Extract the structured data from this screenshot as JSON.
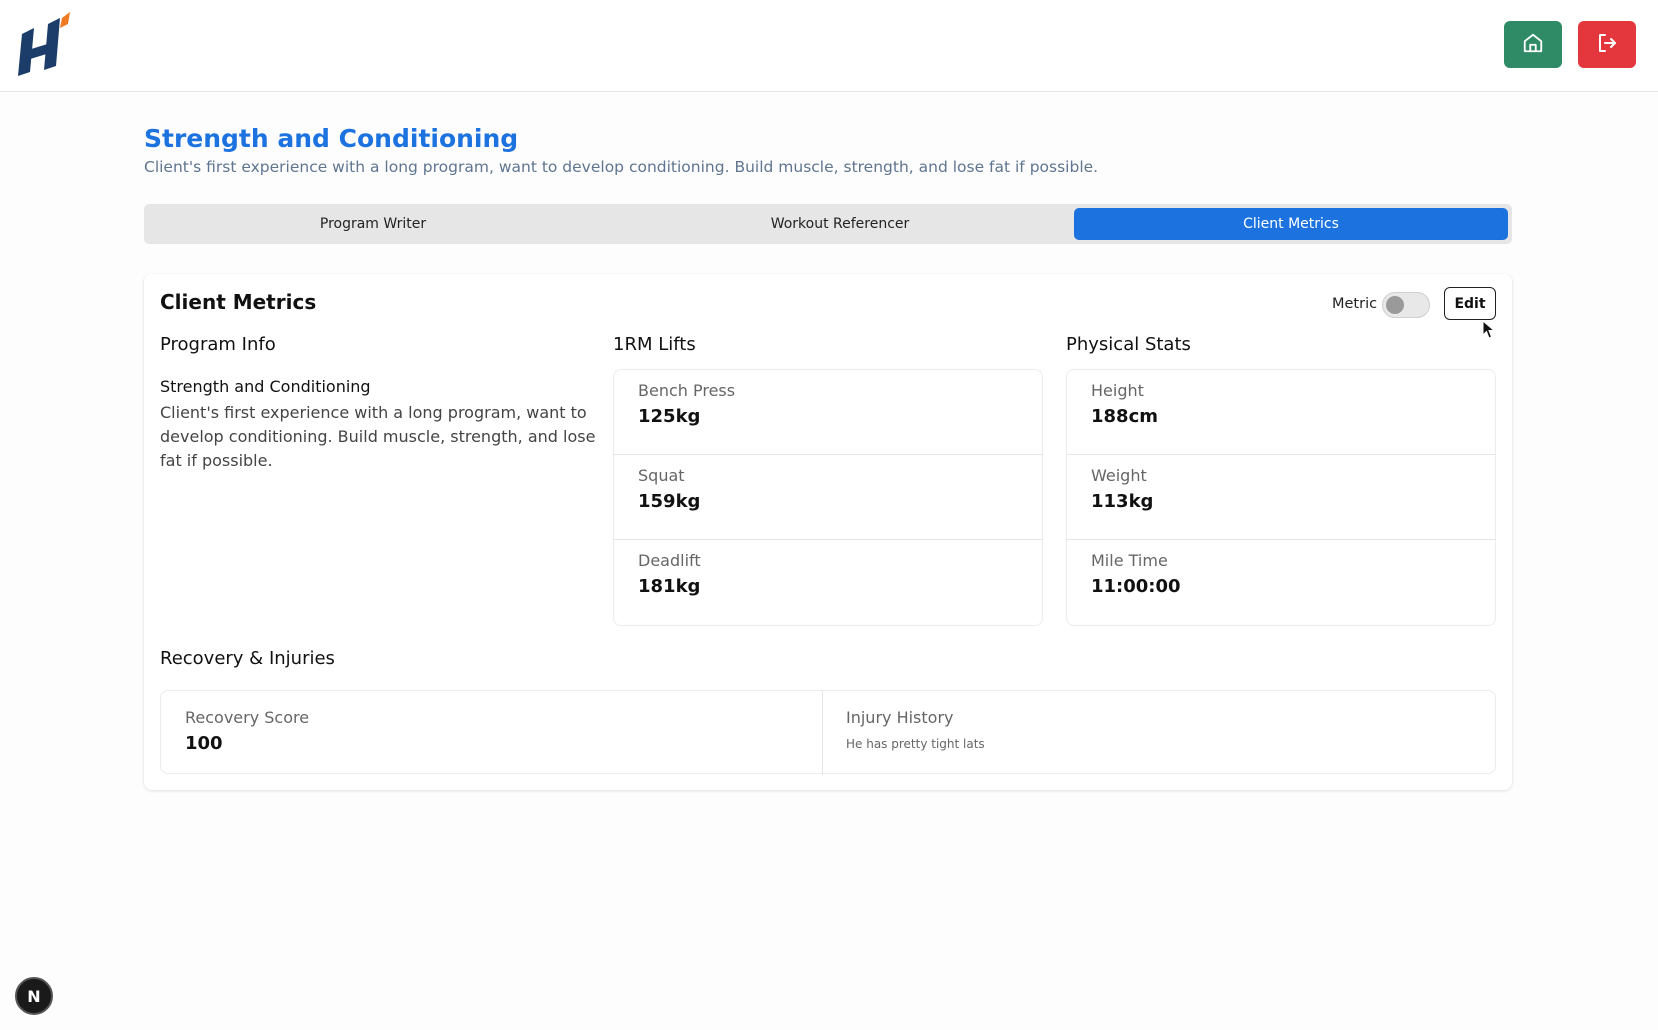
{
  "header": {
    "logo_icon": "h-logo-icon",
    "home_icon": "home-icon",
    "logout_icon": "logout-icon",
    "colors": {
      "home": "#2e8b66",
      "logout": "#e4363d",
      "brand_navy": "#1c3d6a",
      "brand_orange": "#f07a22"
    }
  },
  "page": {
    "title": "Strength and Conditioning",
    "description": "Client's first experience with a long program, want to develop conditioning. Build muscle, strength, and lose fat if possible."
  },
  "tabs": [
    {
      "label": "Program Writer",
      "active": false
    },
    {
      "label": "Workout Referencer",
      "active": false
    },
    {
      "label": "Client Metrics",
      "active": true
    }
  ],
  "card": {
    "title": "Client Metrics",
    "metric_label": "Metric",
    "metric_enabled": false,
    "edit_label": "Edit"
  },
  "program_info": {
    "heading": "Program Info",
    "name": "Strength and Conditioning",
    "description": "Client's first experience with a long program, want to develop conditioning. Build muscle, strength, and lose fat if possible."
  },
  "lifts": {
    "heading": "1RM Lifts",
    "items": [
      {
        "label": "Bench Press",
        "value": "125kg"
      },
      {
        "label": "Squat",
        "value": "159kg"
      },
      {
        "label": "Deadlift",
        "value": "181kg"
      }
    ]
  },
  "physical": {
    "heading": "Physical Stats",
    "items": [
      {
        "label": "Height",
        "value": "188cm"
      },
      {
        "label": "Weight",
        "value": "113kg"
      },
      {
        "label": "Mile Time",
        "value": "11:00:00"
      }
    ]
  },
  "recovery": {
    "heading": "Recovery & Injuries",
    "score_label": "Recovery Score",
    "score_value": "100",
    "injury_label": "Injury History",
    "injury_text": "He has pretty tight lats"
  },
  "dev_badge": {
    "label": "N"
  },
  "colors": {
    "accent": "#1c73e0"
  }
}
